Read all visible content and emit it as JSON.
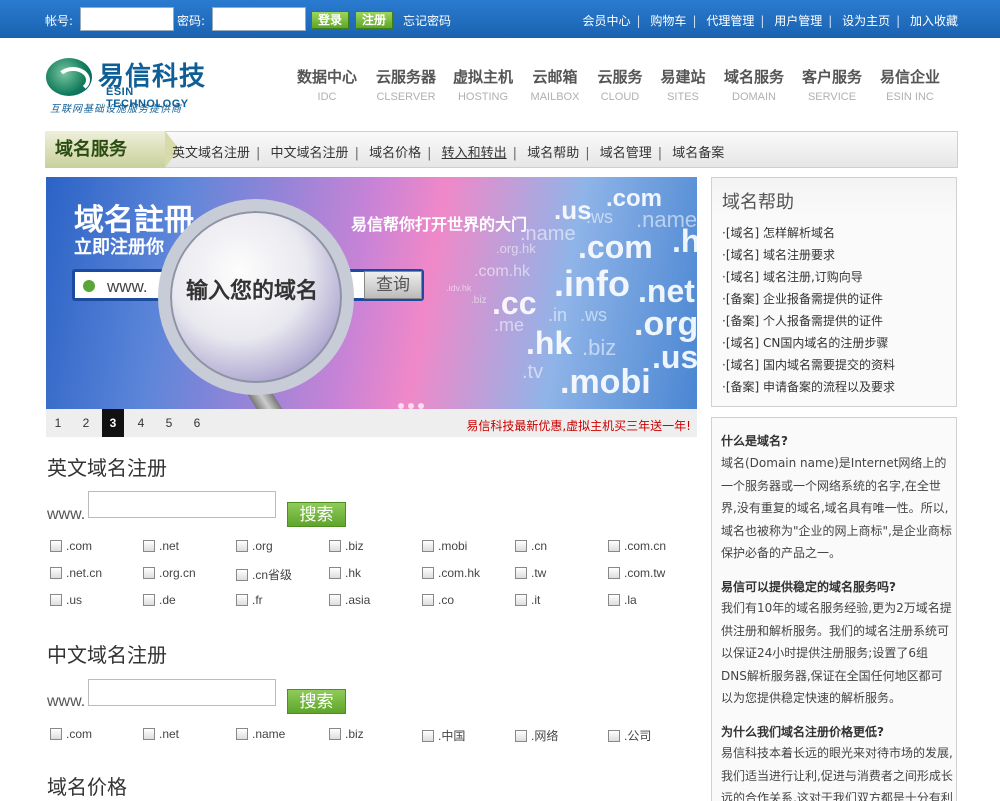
{
  "topbar": {
    "account_label": "帐号:",
    "password_label": "密码:",
    "login_label": "登录",
    "register_label": "注册",
    "forgot_label": "忘记密码",
    "links": [
      "会员中心",
      "购物车",
      "代理管理",
      "用户管理",
      "设为主页",
      "加入收藏"
    ]
  },
  "logo": {
    "cn": "易信科技",
    "en": "ESIN TECHNOLOGY",
    "sub": "互联网基础设施服务提供商"
  },
  "nav": [
    {
      "cn": "数据中心",
      "en": "IDC"
    },
    {
      "cn": "云服务器",
      "en": "CLSERVER"
    },
    {
      "cn": "虚拟主机",
      "en": "HOSTING"
    },
    {
      "cn": "云邮箱",
      "en": "MAILBOX"
    },
    {
      "cn": "云服务",
      "en": "CLOUD"
    },
    {
      "cn": "易建站",
      "en": "SITES"
    },
    {
      "cn": "域名服务",
      "en": "DOMAIN"
    },
    {
      "cn": "客户服务",
      "en": "SERVICE"
    },
    {
      "cn": "易信企业",
      "en": "ESIN INC"
    }
  ],
  "subnav": {
    "title": "域名服务",
    "links": [
      "英文域名注册",
      "中文域名注册",
      "域名价格",
      "转入和转出",
      "域名帮助",
      "域名管理",
      "域名备案"
    ]
  },
  "banner": {
    "heading": "域名註冊",
    "subheading": "立即注册你",
    "slogan": "易信帮你打开世界的大门",
    "www": "www.",
    "lens_text": "输入您的域名",
    "query": "查询",
    "tlds": [
      ".com",
      ".us",
      ".ws",
      ".name",
      ".name",
      ".org.hk",
      ".com",
      ".h",
      ".com.hk",
      ".info",
      ".net",
      ".cc",
      ".in",
      ".ws",
      ".org",
      ".me",
      ".hk",
      ".biz",
      ".us",
      ".tv",
      ".mobi",
      ".idv.hk",
      ".biz"
    ]
  },
  "slider": {
    "pages": [
      "1",
      "2",
      "3",
      "4",
      "5",
      "6"
    ],
    "active": "3",
    "promo": "易信科技最新优惠,虚拟主机买三年送一年!"
  },
  "en_section": {
    "title": "英文域名注册",
    "www": "www.",
    "search": "搜索",
    "tlds": [
      ".com",
      ".net",
      ".org",
      ".biz",
      ".mobi",
      ".cn",
      ".com.cn",
      ".net.cn",
      ".org.cn",
      ".cn省级",
      ".hk",
      ".com.hk",
      ".tw",
      ".com.tw",
      ".us",
      ".de",
      ".fr",
      ".asia",
      ".co",
      ".it",
      ".la"
    ]
  },
  "cn_section": {
    "title": "中文域名注册",
    "www": "www.",
    "search": "搜索",
    "tlds": [
      ".com",
      ".net",
      ".name",
      ".biz",
      ".中国",
      ".网络",
      ".公司"
    ]
  },
  "price_section": {
    "title": "域名价格"
  },
  "help_box": {
    "title": "域名帮助",
    "items": [
      "·[域名] 怎样解析域名",
      "·[域名] 域名注册要求",
      "·[域名] 域名注册,订购向导",
      "·[备案] 企业报备需提供的证件",
      "·[备案] 个人报备需提供的证件",
      "·[域名] CN国内域名的注册步骤",
      "·[域名] 国内域名需要提交的资料",
      "·[备案] 申请备案的流程以及要求"
    ]
  },
  "faq": [
    {
      "q": "什么是域名?",
      "a": "域名(Domain name)是Internet网络上的一个服务器或一个网络系统的名字,在全世界,没有重复的域名,域名具有唯一性。所以,域名也被称为\"企业的网上商标\",是企业商标保护必备的产品之一。"
    },
    {
      "q": "易信可以提供稳定的域名服务吗?",
      "a": "我们有10年的域名服务经验,更为2万域名提供注册和解析服务。我们的域名注册系统可以保证24小时提供注册服务;设置了6组DNS解析服务器,保证在全国任何地区都可以为您提供稳定快速的解析服务。"
    },
    {
      "q": "为什么我们域名注册价格更低?",
      "a": "易信科技本着长远的眼光来对待市场的发展,我们适当进行让利,促进与消费者之间形成长远的合作关系,这对于我们双方都是十分有利"
    }
  ],
  "colors": {
    "topbar": "#1f6fc3",
    "accent_green": "#5ea52a",
    "promo_red": "#cc0000"
  }
}
